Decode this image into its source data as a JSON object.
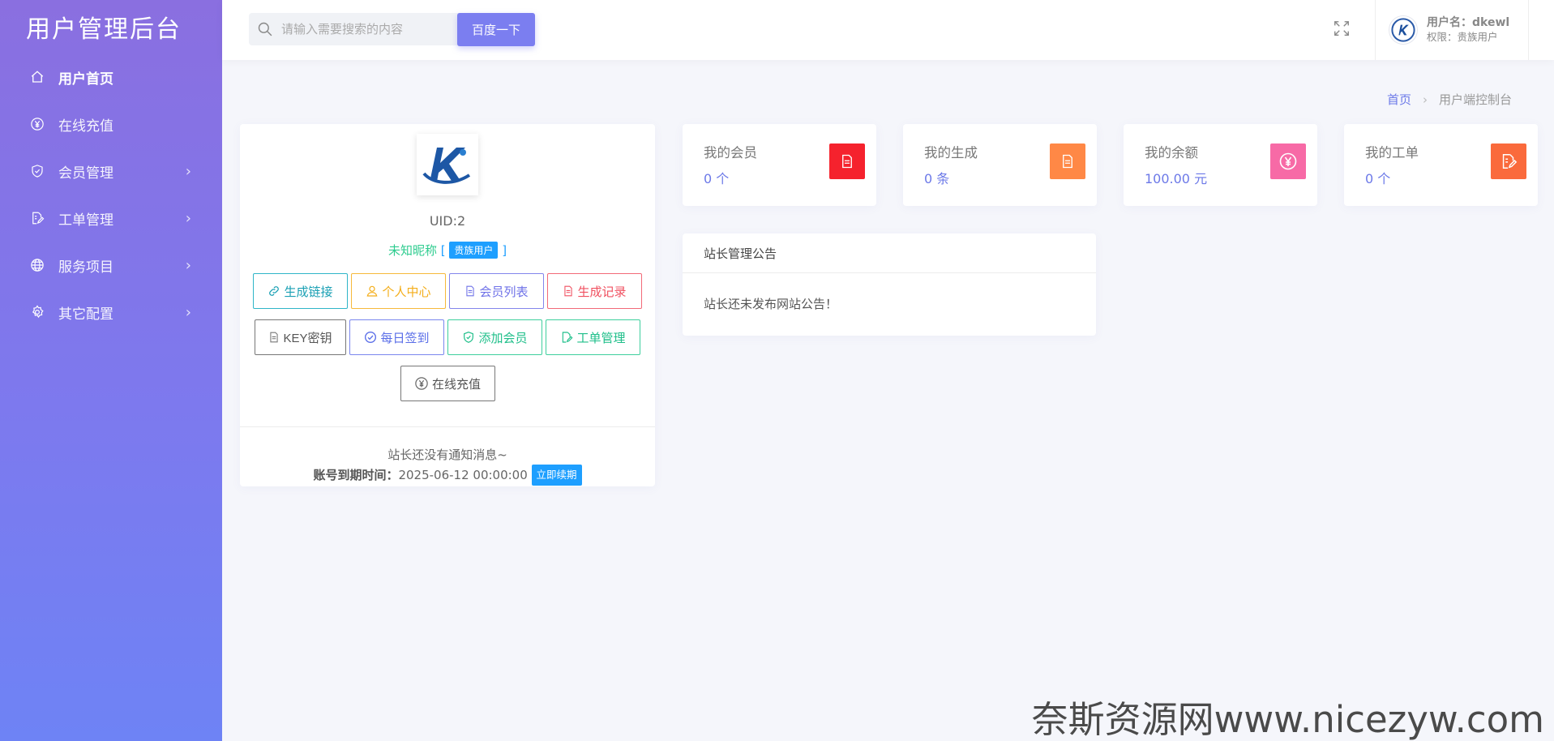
{
  "brand": {
    "title": "用户管理后台"
  },
  "sidebar": {
    "items": [
      {
        "label": "用户首页",
        "icon": "home-icon",
        "active": true,
        "has_children": false
      },
      {
        "label": "在线充值",
        "icon": "yen-circle-icon",
        "active": false,
        "has_children": false
      },
      {
        "label": "会员管理",
        "icon": "shield-check-icon",
        "active": false,
        "has_children": true
      },
      {
        "label": "工单管理",
        "icon": "edit-doc-icon",
        "active": false,
        "has_children": true
      },
      {
        "label": "服务项目",
        "icon": "globe-icon",
        "active": false,
        "has_children": true
      },
      {
        "label": "其它配置",
        "icon": "gear-icon",
        "active": false,
        "has_children": true
      }
    ]
  },
  "topbar": {
    "search_placeholder": "请输入需要搜索的内容",
    "search_button": "百度一下",
    "user_name": "用户名：dkewl",
    "user_role": "权限：贵族用户"
  },
  "breadcrumb": {
    "home": "首页",
    "current": "用户端控制台"
  },
  "profile": {
    "uid": "UID:2",
    "nickname": "未知昵称",
    "bracket_open": "[",
    "bracket_close": "]",
    "role_tag": "贵族用户",
    "buttons_row1": [
      "生成链接",
      "个人中心",
      "会员列表",
      "生成记录"
    ],
    "buttons_row2": [
      "KEY密钥",
      "每日签到",
      "添加会员",
      "工单管理"
    ],
    "button_row3": "在线充值",
    "notice": "站长还没有通知消息~",
    "expire_label": "账号到期时间：",
    "expire_time": "2025-06-12 00:00:00",
    "renew": "立即续期"
  },
  "stats": [
    {
      "title": "我的会员",
      "value": "0 个",
      "color": "#f5222d",
      "icon": "document-icon"
    },
    {
      "title": "我的生成",
      "value": "0 条",
      "color": "#ff8846",
      "icon": "document-icon"
    },
    {
      "title": "我的余额",
      "value": "100.00 元",
      "color": "#f76aa6",
      "icon": "yen-circle-icon"
    },
    {
      "title": "我的工单",
      "value": "0 个",
      "color": "#fa6a3c",
      "icon": "edit-doc-icon"
    }
  ],
  "notice_card": {
    "title": "站长管理公告",
    "body": "站长还未发布网站公告！"
  },
  "watermark": "奈斯资源网www.nicezyw.com",
  "colors": {
    "accent": "#7b7ef0",
    "sidebar_top": "#8a6fe0",
    "sidebar_bottom": "#6e83f5",
    "tag_blue": "#1e9fff"
  }
}
